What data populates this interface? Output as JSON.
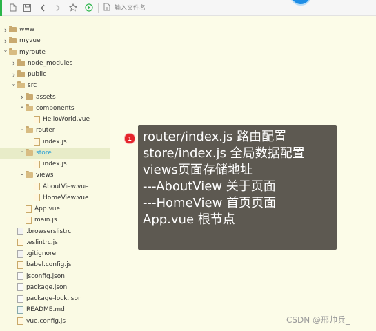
{
  "toolbar": {
    "search": {
      "placeholder": "输入文件名"
    },
    "icons": [
      "new-file-icon",
      "save-icon",
      "back-arrow-icon",
      "forward-arrow-icon",
      "star-icon",
      "run-icon",
      "file-browser-icon"
    ]
  },
  "tree": [
    {
      "label": "www",
      "type": "folder",
      "depth": 0,
      "expanded": false
    },
    {
      "label": "myvue",
      "type": "folder",
      "depth": 0,
      "expanded": false
    },
    {
      "label": "myroute",
      "type": "folder",
      "depth": 0,
      "expanded": true
    },
    {
      "label": "node_modules",
      "type": "folder",
      "depth": 1,
      "expanded": false
    },
    {
      "label": "public",
      "type": "folder",
      "depth": 1,
      "expanded": false
    },
    {
      "label": "src",
      "type": "folder",
      "depth": 1,
      "expanded": true
    },
    {
      "label": "assets",
      "type": "folder",
      "depth": 2,
      "expanded": false
    },
    {
      "label": "components",
      "type": "folder",
      "depth": 2,
      "expanded": true
    },
    {
      "label": "HelloWorld.vue",
      "type": "file",
      "depth": 3
    },
    {
      "label": "router",
      "type": "folder",
      "depth": 2,
      "expanded": true
    },
    {
      "label": "index.js",
      "type": "file",
      "depth": 3
    },
    {
      "label": "store",
      "type": "folder",
      "depth": 2,
      "expanded": true,
      "selected": true
    },
    {
      "label": "index.js",
      "type": "file",
      "depth": 3
    },
    {
      "label": "views",
      "type": "folder",
      "depth": 2,
      "expanded": true
    },
    {
      "label": "AboutView.vue",
      "type": "file",
      "depth": 3
    },
    {
      "label": "HomeView.vue",
      "type": "file",
      "depth": 3
    },
    {
      "label": "App.vue",
      "type": "file",
      "depth": 2
    },
    {
      "label": "main.js",
      "type": "file",
      "depth": 2
    },
    {
      "label": ".browserslistrc",
      "type": "file",
      "depth": 1,
      "kind": "txt"
    },
    {
      "label": ".eslintrc.js",
      "type": "file",
      "depth": 1
    },
    {
      "label": ".gitignore",
      "type": "file",
      "depth": 1,
      "kind": "txt"
    },
    {
      "label": "babel.config.js",
      "type": "file",
      "depth": 1
    },
    {
      "label": "jsconfig.json",
      "type": "file",
      "depth": 1,
      "kind": "json"
    },
    {
      "label": "package.json",
      "type": "file",
      "depth": 1,
      "kind": "json"
    },
    {
      "label": "package-lock.json",
      "type": "file",
      "depth": 1,
      "kind": "json"
    },
    {
      "label": "README.md",
      "type": "file",
      "depth": 1,
      "kind": "md"
    },
    {
      "label": "vue.config.js",
      "type": "file",
      "depth": 1
    }
  ],
  "callout": {
    "badge": "1",
    "lines": [
      "router/index.js 路由配置",
      "store/index.js 全局数据配置",
      "views页面存储地址",
      "---AboutView 关于页面",
      "---HomeView 首页页面",
      "App.vue 根节点"
    ]
  },
  "watermark": "CSDN @邢帅兵_"
}
